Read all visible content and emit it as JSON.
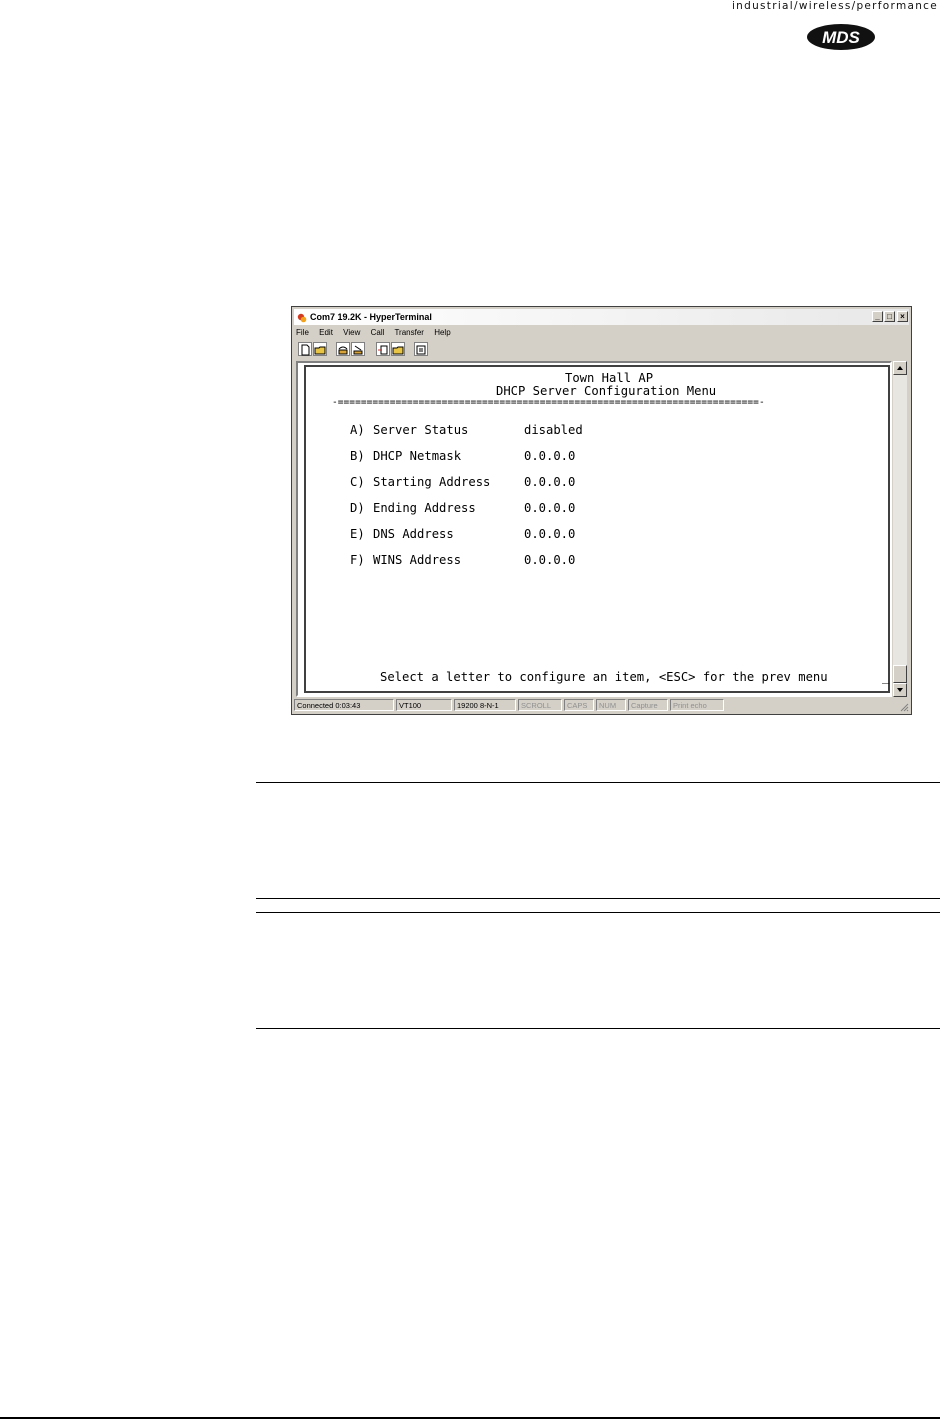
{
  "header": {
    "tagline": "industrial/wireless/performance",
    "logo_text": "MDS"
  },
  "window": {
    "title": "Com7 19.2K - HyperTerminal",
    "controls": {
      "minimize": "_",
      "maximize": "□",
      "close": "×"
    },
    "menu": [
      "File",
      "Edit",
      "View",
      "Call",
      "Transfer",
      "Help"
    ],
    "toolbar_icons": [
      "new-icon",
      "open-icon",
      "phone-icon",
      "disconnect-icon",
      "send-icon",
      "receive-icon",
      "properties-icon"
    ]
  },
  "terminal": {
    "device_name": "Town Hall AP",
    "menu_title": "DHCP Server Configuration Menu",
    "separator": "-=========================================================================-",
    "items": [
      {
        "key": "A)",
        "label": "Server Status",
        "value": "disabled"
      },
      {
        "key": "B)",
        "label": "DHCP Netmask",
        "value": "0.0.0.0"
      },
      {
        "key": "C)",
        "label": "Starting Address",
        "value": "0.0.0.0"
      },
      {
        "key": "D)",
        "label": "Ending Address",
        "value": "0.0.0.0"
      },
      {
        "key": "E)",
        "label": "DNS Address",
        "value": "0.0.0.0"
      },
      {
        "key": "F)",
        "label": "WINS Address",
        "value": "0.0.0.0"
      }
    ],
    "prompt": "Select a letter to configure an item, <ESC> for the prev menu",
    "cursor": "_"
  },
  "statusbar": {
    "connected": "Connected 0:03:43",
    "emulation": "VT100",
    "port_settings": "19200 8-N-1",
    "scroll": "SCROLL",
    "caps": "CAPS",
    "num": "NUM",
    "capture": "Capture",
    "print_echo": "Print echo"
  }
}
